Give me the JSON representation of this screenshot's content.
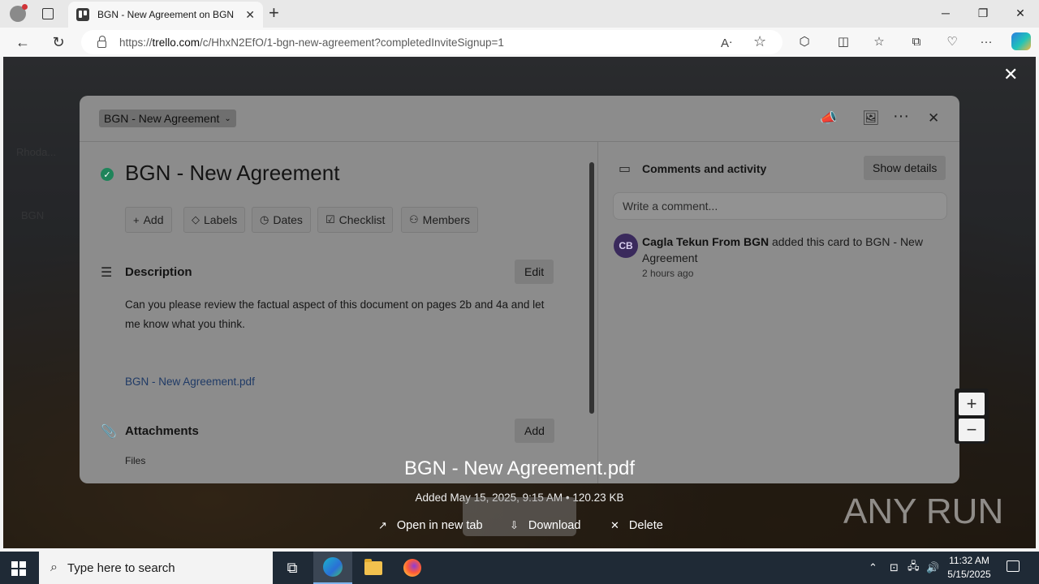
{
  "browser": {
    "tab_title": "BGN - New Agreement on BGN",
    "url_prefix": "https://",
    "url_domain": "trello.com",
    "url_path": "/c/HhxN2EfO/1-bgn-new-agreement?completedInviteSignup=1",
    "window_controls": {
      "minimize": "─",
      "restore": "❐",
      "close": "✕"
    },
    "icons": [
      "profile-icon",
      "tab-actions-icon",
      "trello-favicon",
      "back-icon",
      "refresh-icon",
      "lock-icon",
      "read-aloud-icon",
      "favorite-star-icon",
      "extensions-icon",
      "split-screen-icon",
      "favorites-icon",
      "collections-icon",
      "performance-icon",
      "more-icon",
      "copilot-icon"
    ]
  },
  "card": {
    "list_name": "BGN - New Agreement",
    "title": "BGN - New Agreement",
    "actions": [
      "Add",
      "Labels",
      "Dates",
      "Checklist",
      "Members"
    ],
    "description_heading": "Description",
    "description_edit": "Edit",
    "description_text": "Can you please review the factual aspect of this document on pages 2b and 4a and let me know what you think.",
    "description_link": "BGN - New Agreement.pdf",
    "attachments_heading": "Attachments",
    "attachments_add": "Add",
    "files_label": "Files"
  },
  "activity": {
    "heading": "Comments and activity",
    "show_details": "Show details",
    "comment_placeholder": "Write a comment...",
    "avatar_initials": "CB",
    "author": "Cagla Tekun From BGN",
    "action_text": "added this card to BGN - New Agreement",
    "time": "2 hours ago"
  },
  "viewer": {
    "file_name": "BGN - New Agreement.pdf",
    "file_meta": "Added May 15, 2025, 9:15 AM • 120.23 KB",
    "open_new_tab": "Open in new tab",
    "download": "Download",
    "delete": "Delete",
    "zoom_in": "+",
    "zoom_out": "−"
  },
  "watermark": "ANY RUN",
  "taskbar": {
    "search_placeholder": "Type here to search",
    "time": "11:32 AM",
    "date": "5/15/2025"
  },
  "colors": {
    "done_green": "#1f845a",
    "link_blue": "#1f3a66",
    "taskbar": "#1f2a36"
  }
}
